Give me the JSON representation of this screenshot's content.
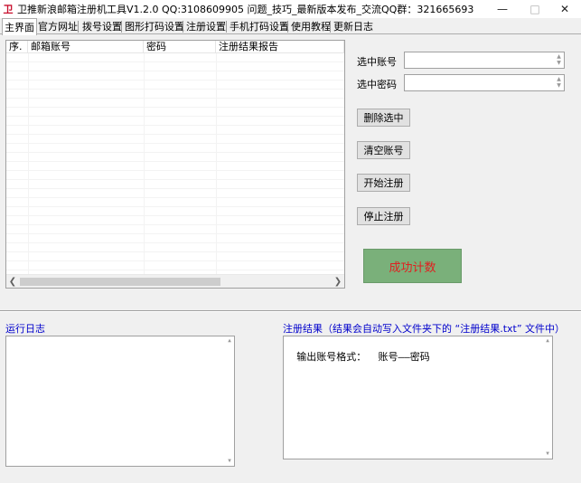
{
  "window": {
    "title": "卫推新浪邮箱注册机工具V1.2.0 QQ:3108609905 问题_技巧_最新版本发布_交流QQ群：321665693",
    "icon": "app-logo-icon"
  },
  "tabs": [
    {
      "label": "主界面",
      "active": true
    },
    {
      "label": "官方网址"
    },
    {
      "label": "拨号设置"
    },
    {
      "label": "图形打码设置"
    },
    {
      "label": "注册设置"
    },
    {
      "label": "手机打码设置"
    },
    {
      "label": "使用教程"
    },
    {
      "label": "更新日志"
    }
  ],
  "table": {
    "columns": [
      "序.",
      "邮箱账号",
      "密码",
      "注册结果报告"
    ],
    "rows": []
  },
  "form": {
    "account_label": "选中账号",
    "account_value": "",
    "password_label": "选中密码",
    "password_value": ""
  },
  "buttons": {
    "delete_selected": "删除选中",
    "clear_accounts": "清空账号",
    "start_register": "开始注册",
    "stop_register": "停止注册"
  },
  "counter": {
    "label": "成功计数",
    "bg_color": "#7ab07a",
    "text_color": "#e02020"
  },
  "log": {
    "title": "运行日志",
    "content": ""
  },
  "result": {
    "title": "注册结果（结果会自动写入文件夹下的 “注册结果.txt” 文件中）",
    "content": "输出账号格式：  账号——密码"
  }
}
